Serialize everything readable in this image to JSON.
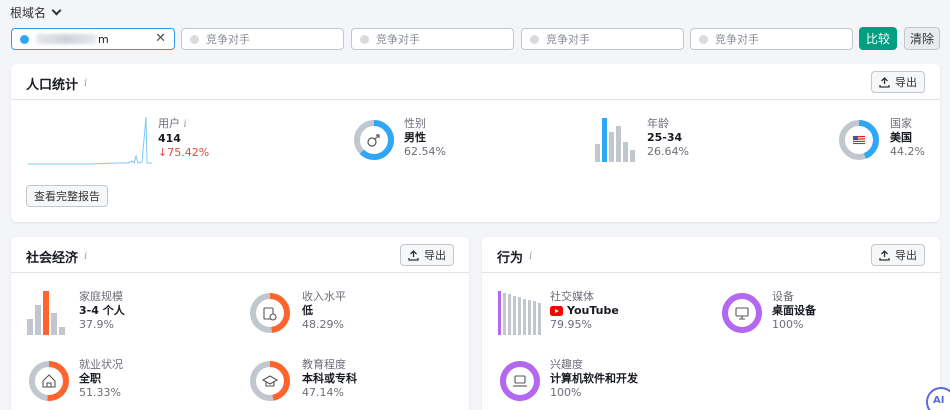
{
  "toolbar": {
    "domain_selector_label": "根域名",
    "primary_field_suffix": "m",
    "competitor_placeholder": "竞争对手",
    "compare_label": "比较",
    "clear_label": "清除"
  },
  "export_label": "导出",
  "demographics": {
    "title": "人口统计",
    "users": {
      "label": "用户",
      "value": "414",
      "change": "↓75.42%"
    },
    "gender": {
      "label": "性别",
      "value": "男性",
      "percent": "62.54%",
      "share": 0.6254
    },
    "age": {
      "label": "年龄",
      "value": "25-34",
      "percent": "26.64%"
    },
    "country": {
      "label": "国家",
      "value": "美国",
      "percent": "44.2%",
      "share": 0.442
    },
    "full_report_label": "查看完整报告"
  },
  "socioeconomic": {
    "title": "社会经济",
    "household": {
      "label": "家庭规模",
      "value": "3-4 个人",
      "percent": "37.9%"
    },
    "income": {
      "label": "收入水平",
      "value": "低",
      "percent": "48.29%",
      "share": 0.4829
    },
    "employment": {
      "label": "就业状况",
      "value": "全职",
      "percent": "51.33%",
      "share": 0.5133
    },
    "education": {
      "label": "教育程度",
      "value": "本科或专科",
      "percent": "47.14%",
      "share": 0.4714
    }
  },
  "behavior": {
    "title": "行为",
    "social": {
      "label": "社交媒体",
      "value": "YouTube",
      "percent": "79.95%"
    },
    "device": {
      "label": "设备",
      "value": "桌面设备",
      "percent": "100%",
      "share": 1.0
    },
    "interest": {
      "label": "兴趣度",
      "value": "计算机软件和开发",
      "percent": "100%",
      "share": 1.0
    }
  },
  "help": {
    "label": "AI"
  },
  "colors": {
    "accent": "#2fa7f5",
    "orange": "#ff642d",
    "purple": "#b467f0",
    "compare_green": "#009f81",
    "grey": "#c2c7cf"
  }
}
